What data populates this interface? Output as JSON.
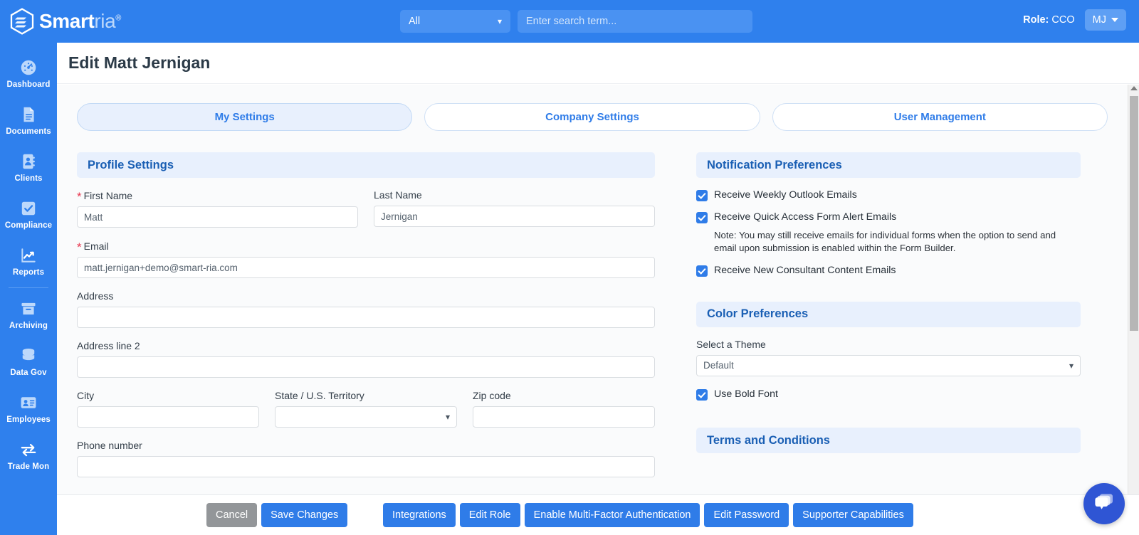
{
  "brand": {
    "name_main": "Smart",
    "name_dim": "ria",
    "registered": "®"
  },
  "topbar": {
    "search_scope": "All",
    "search_scope_icon": "chevron-down-icon",
    "search_placeholder": "Enter search term...",
    "search_value": "",
    "role_prefix": "Role:",
    "role_value": "CCO",
    "avatar_initials": "MJ",
    "accent": "#2f80ed"
  },
  "sidebar": {
    "items": [
      {
        "label": "Dashboard",
        "icon": "gauge-icon"
      },
      {
        "label": "Documents",
        "icon": "document-icon"
      },
      {
        "label": "Clients",
        "icon": "address-book-icon"
      },
      {
        "label": "Compliance",
        "icon": "checkbox-check-icon"
      },
      {
        "label": "Reports",
        "icon": "chart-line-icon"
      },
      {
        "label": "Archiving",
        "icon": "archive-box-icon"
      },
      {
        "label": "Data Gov",
        "icon": "database-icon"
      },
      {
        "label": "Employees",
        "icon": "id-card-icon"
      },
      {
        "label": "Trade Mon",
        "icon": "exchange-arrows-icon"
      }
    ]
  },
  "page": {
    "title": "Edit Matt Jernigan"
  },
  "tabs": [
    {
      "label": "My Settings",
      "active": true
    },
    {
      "label": "Company Settings",
      "active": false
    },
    {
      "label": "User Management",
      "active": false
    }
  ],
  "profile": {
    "section_title": "Profile Settings",
    "first_name": {
      "label": "First Name",
      "required": true,
      "value": "Matt",
      "placeholder": ""
    },
    "last_name": {
      "label": "Last Name",
      "required": false,
      "value": "Jernigan",
      "placeholder": ""
    },
    "email": {
      "label": "Email",
      "required": true,
      "value": "matt.jernigan+demo@smart-ria.com",
      "placeholder": ""
    },
    "address": {
      "label": "Address",
      "required": false,
      "value": "",
      "placeholder": ""
    },
    "address2": {
      "label": "Address line 2",
      "required": false,
      "value": "",
      "placeholder": ""
    },
    "city": {
      "label": "City",
      "required": false,
      "value": "",
      "placeholder": ""
    },
    "state": {
      "label": "State / U.S. Territory",
      "required": false,
      "value": "",
      "icon": "chevron-down-icon"
    },
    "zip": {
      "label": "Zip code",
      "required": false,
      "value": "",
      "placeholder": ""
    },
    "phone": {
      "label": "Phone number",
      "required": false,
      "value": "",
      "placeholder": ""
    }
  },
  "notifications": {
    "section_title": "Notification Preferences",
    "items": [
      {
        "label": "Receive Weekly Outlook Emails",
        "checked": true
      },
      {
        "label": "Receive Quick Access Form Alert Emails",
        "checked": true
      },
      {
        "label": "Receive New Consultant Content Emails",
        "checked": true
      }
    ],
    "note": "Note: You may still receive emails for individual forms when the option to send and email upon submission is enabled within the Form Builder."
  },
  "colors": {
    "section_title": "Color Preferences",
    "theme_label": "Select a Theme",
    "theme_value": "Default",
    "theme_icon": "chevron-down-icon",
    "bold_font_label": "Use Bold Font",
    "bold_font_checked": true
  },
  "terms": {
    "section_title": "Terms and Conditions"
  },
  "footer": {
    "cancel": "Cancel",
    "save": "Save Changes",
    "integrations": "Integrations",
    "edit_role": "Edit Role",
    "mfa": "Enable Multi-Factor Authentication",
    "edit_password": "Edit Password",
    "supporter": "Supporter Capabilities"
  },
  "chat": {
    "icon": "chat-bubbles-icon"
  },
  "scrollbar": {
    "icon": "scroll-up-arrow-icon"
  }
}
